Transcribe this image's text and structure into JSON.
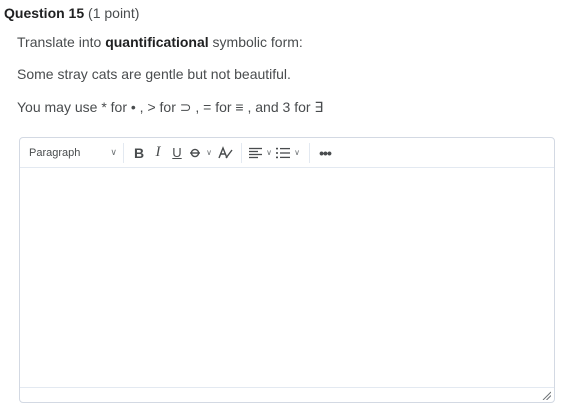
{
  "question": {
    "title": "Question 15",
    "points": "(1 point)"
  },
  "prompt": {
    "line1_prefix": "Translate into ",
    "line1_bold": "quantificational",
    "line1_suffix": " symbolic form:",
    "sentence": "Some stray cats are gentle but not beautiful.",
    "instructions": "You may use  * for • , > for ⊃ ,  = for ≡ , and 3 for ∃"
  },
  "editor": {
    "format_select": "Paragraph",
    "toolbar": {
      "bold": "B",
      "italic": "I",
      "underline": "U",
      "more": "•••"
    },
    "content": ""
  }
}
